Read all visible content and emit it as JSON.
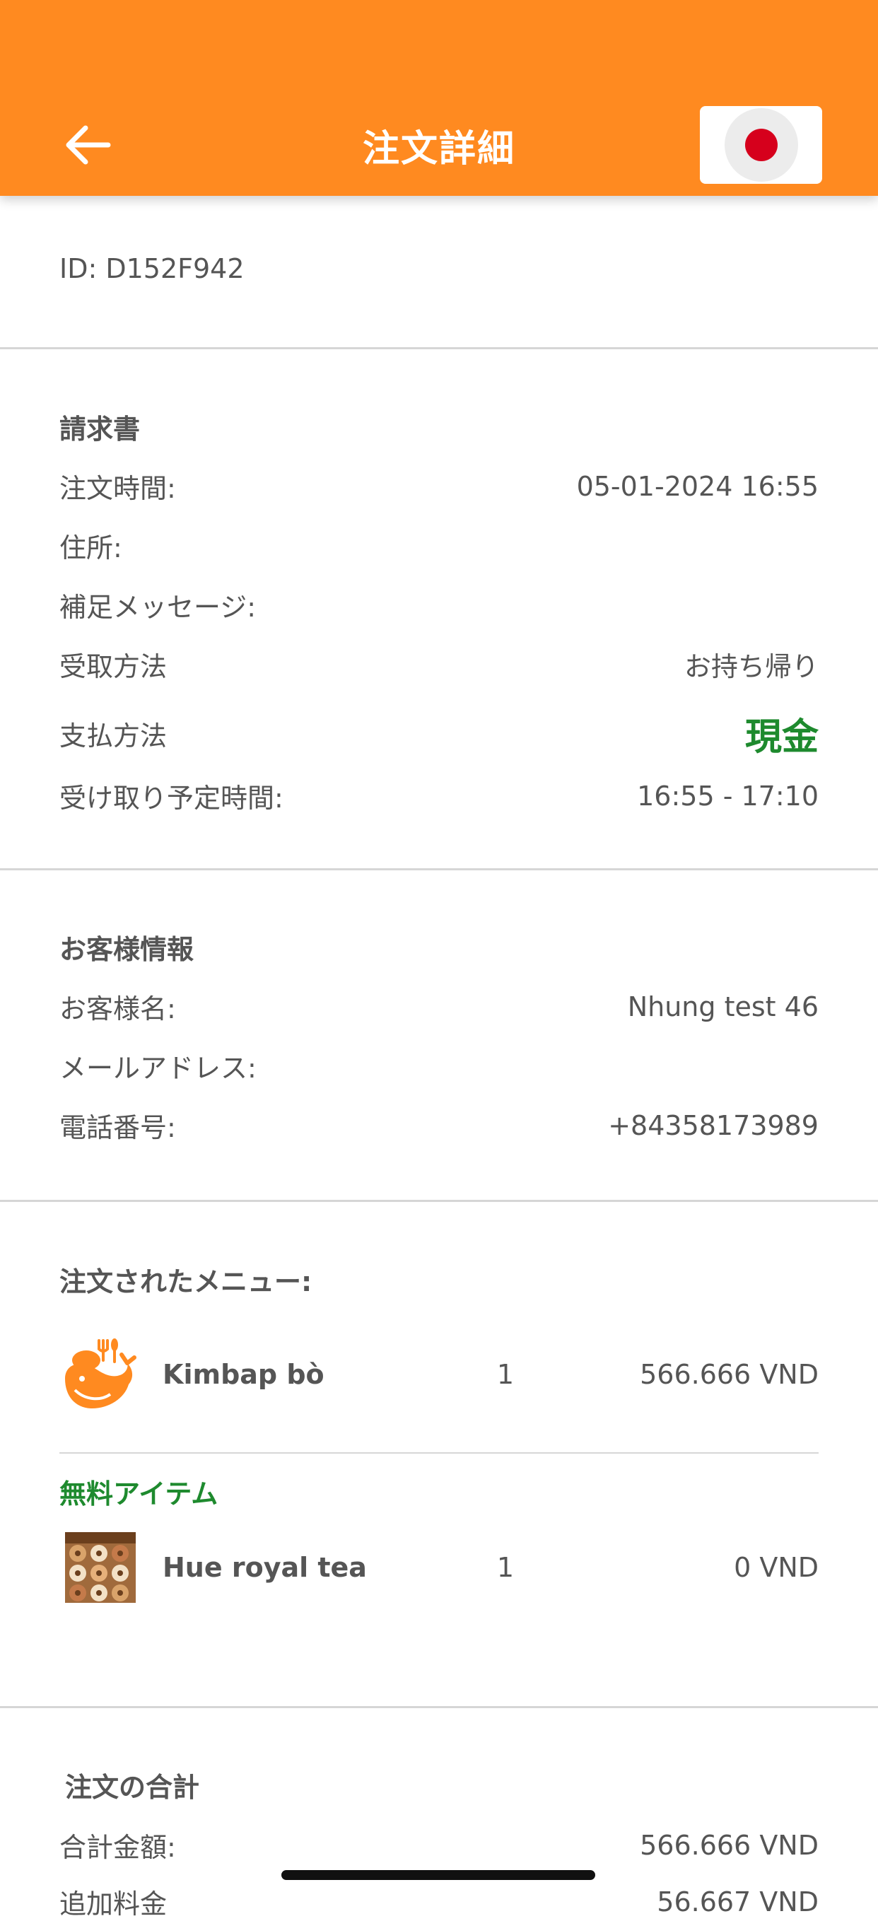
{
  "header": {
    "title": "注文詳細",
    "back_icon": "arrow-left-icon",
    "language_flag": "japan-flag-icon",
    "bg_color": "#ff8a20"
  },
  "order": {
    "id": "ID: D152F942"
  },
  "invoice": {
    "title": "請求書",
    "order_time_label": "注文時間:",
    "order_time_value": "05-01-2024 16:55",
    "address_label": "住所:",
    "note_label": "補足メッセージ:",
    "receive_method_label": "受取方法",
    "receive_method_value": "お持ち帰り",
    "payment_method_label": "支払方法",
    "payment_method_value": "現金",
    "pickup_time_label": "受け取り予定時間:",
    "pickup_time_value": "16:55 - 17:10"
  },
  "customer": {
    "title": "お客様情報",
    "name_label": "お客様名:",
    "name_value": "Nhung test 46",
    "email_label": "メールアドレス:",
    "phone_label": "電話番号:",
    "phone_value": "+84358173989"
  },
  "menu": {
    "title": "注文されたメニュー:",
    "items": [
      {
        "name": "Kimbap bò",
        "qty": "1",
        "price": "566.666 VND",
        "icon": "whale-logo-icon"
      }
    ],
    "free_title": "無料アイテム",
    "free_items": [
      {
        "name": "Hue royal tea",
        "qty": "1",
        "price": "0 VND",
        "icon": "donut-photo-thumbnail"
      }
    ]
  },
  "summary": {
    "title": "注文の合計",
    "total_label": "合計金額:",
    "total_value": "566.666 VND",
    "extra_label": "追加料金",
    "extra_value": "56.667 VND"
  }
}
